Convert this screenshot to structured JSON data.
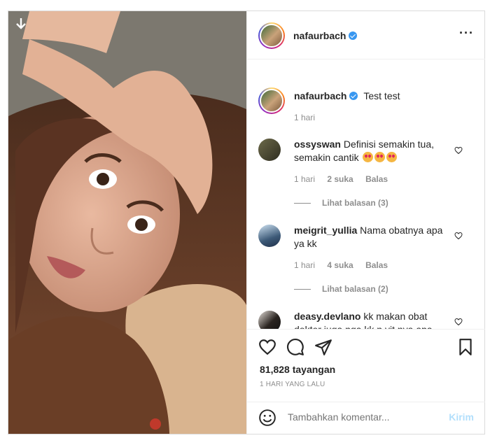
{
  "post": {
    "username": "nafaurbach",
    "caption": "Test test",
    "caption_time": "1 hari",
    "views": "81,828 tayangan",
    "posted": "1 HARI YANG LALU"
  },
  "comments": [
    {
      "user": "ossyswan",
      "text": "Definisi semakin tua, semakin cantik",
      "emoji_count": 3,
      "time": "1 hari",
      "likes": "2 suka",
      "reply": "Balas",
      "view_replies": "Lihat balasan (3)"
    },
    {
      "user": "meigrit_yullia",
      "text": "Nama obatnya apa ya kk",
      "time": "1 hari",
      "likes": "4 suka",
      "reply": "Balas",
      "view_replies": "Lihat balasan (2)"
    },
    {
      "user": "deasy.devlano",
      "text": "kk makan obat dokter juga nga kk n vit nya apa"
    }
  ],
  "add_comment": {
    "placeholder": "Tambahkan komentar...",
    "post_label": "Kirim"
  },
  "colors": {
    "verified": "#3897f0",
    "post_disabled": "#b2dffc",
    "meta": "#8e8e8e"
  }
}
